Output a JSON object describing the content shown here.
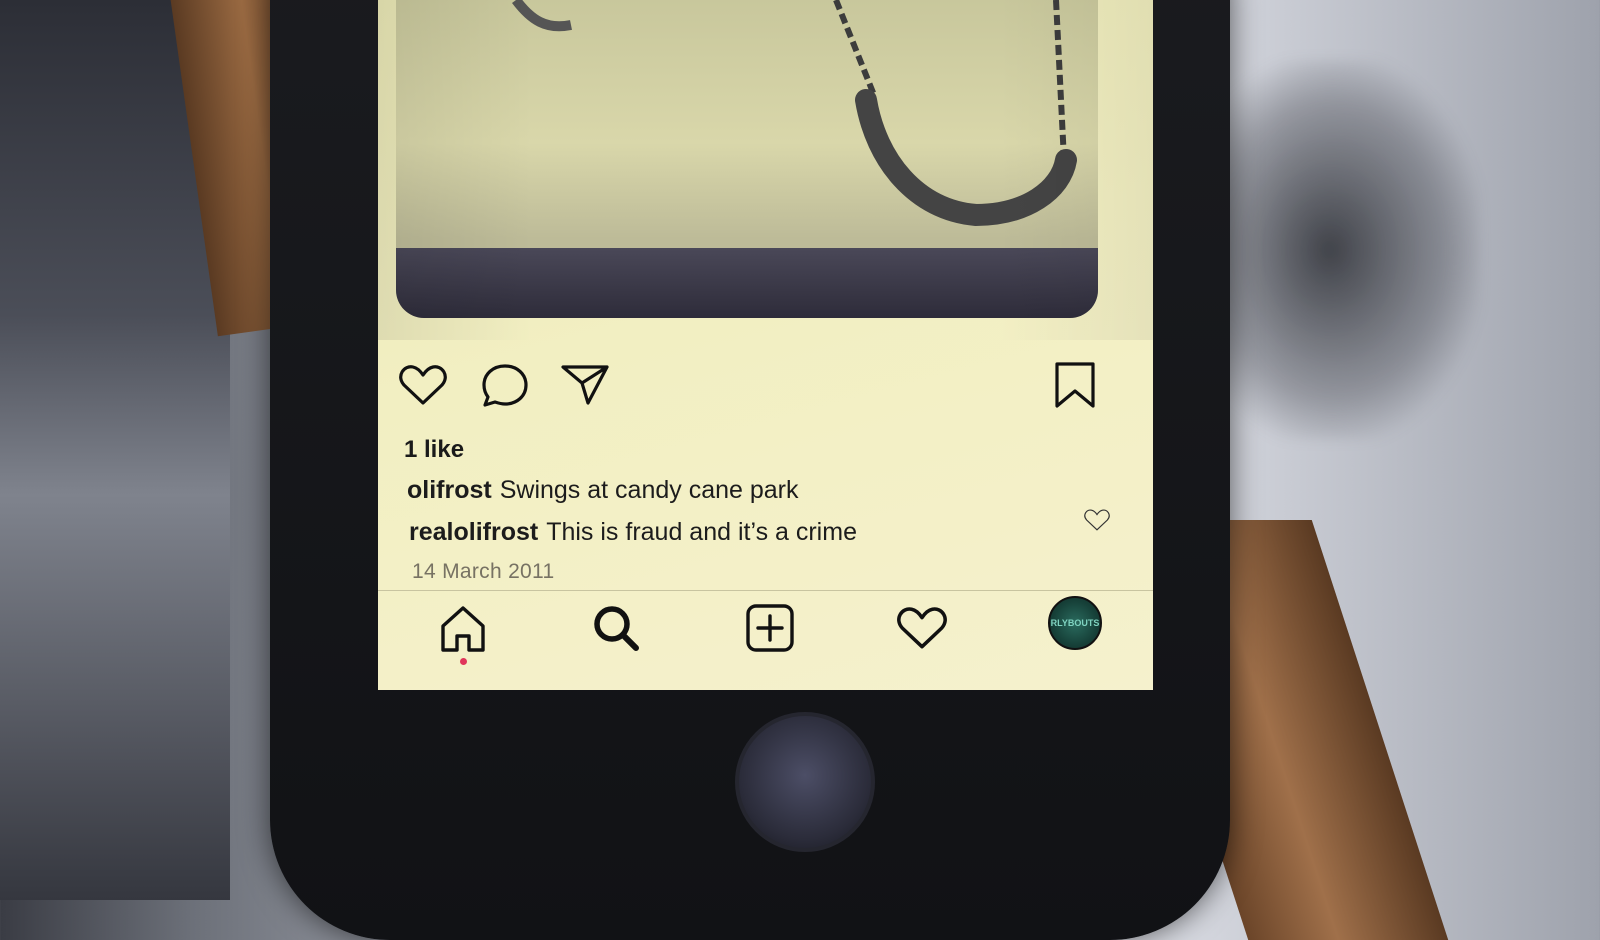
{
  "post": {
    "likes": "1 like",
    "caption": {
      "user": "olifrost",
      "text": "Swings at candy cane park"
    },
    "comment": {
      "user": "realolifrost",
      "text": "This is fraud and it’s a crime"
    },
    "date": "14 March 2011"
  },
  "actions": {
    "icons": [
      "heart-icon",
      "comment-icon",
      "share-icon",
      "bookmark-icon"
    ]
  },
  "tabbar": {
    "icons": [
      "home-icon",
      "search-icon",
      "add-icon",
      "activity-icon",
      "profile-avatar"
    ],
    "active": "home",
    "avatar_text": "RLYBOUTS"
  },
  "colors": {
    "screen_bg": "#f2efc2",
    "text": "#1c1c1c",
    "date_text": "#777263",
    "active_dot": "#e0355a"
  }
}
